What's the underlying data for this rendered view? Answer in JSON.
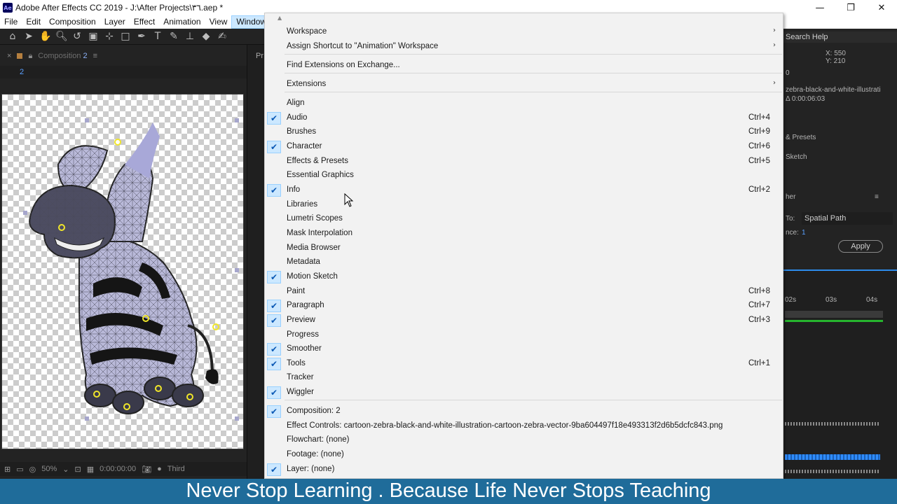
{
  "window": {
    "app_icon": "Ae",
    "title": "Adobe After Effects CC 2019 - J:\\After Projects\\٣٦.aep *",
    "minimize": "—",
    "restore": "❐",
    "close": "✕"
  },
  "menubar": {
    "items": [
      "File",
      "Edit",
      "Composition",
      "Layer",
      "Effect",
      "Animation",
      "View",
      "Window"
    ],
    "active": "Window"
  },
  "toolbar": {
    "icons": [
      "home-icon",
      "selection-tool-icon",
      "hand-tool-icon",
      "zoom-tool-icon",
      "rotate-tool-icon",
      "camera-tool-icon",
      "pan-behind-tool-icon",
      "rectangle-tool-icon",
      "pen-tool-icon",
      "type-tool-icon",
      "brush-tool-icon",
      "clone-stamp-tool-icon",
      "eraser-tool-icon",
      "roto-brush-tool-icon"
    ]
  },
  "composition_panel": {
    "tab_label_prefix": "Composition ",
    "tab_label_number": "2",
    "sub_tab": "2",
    "footer": {
      "zoom": "50%",
      "timecode": "0:00:00:00",
      "view": "Third"
    }
  },
  "middle_strip": {
    "label": "Pr"
  },
  "right_panel": {
    "search_help": "Search Help",
    "info_xy": "X: 550\nY: 210",
    "info_value": "0",
    "project_item": "zebra-black-and-white-illustrati",
    "duration": "Δ 0:00:06:03",
    "effects_presets": "& Presets",
    "motion_sketch": "Sketch",
    "smoother": "her",
    "apply_to_label": "To:",
    "apply_to_value": "Spatial Path",
    "tolerance_label": "nce:",
    "tolerance_value": "1",
    "apply_button": "Apply",
    "ruler_ticks": [
      "02s",
      "03s",
      "04s"
    ]
  },
  "window_menu": {
    "items": [
      {
        "label": "Workspace",
        "checked": false,
        "shortcut": "",
        "submenu": true
      },
      {
        "label": "Assign Shortcut to \"Animation\" Workspace",
        "checked": false,
        "shortcut": "",
        "submenu": true
      },
      {
        "label": "Find Extensions on Exchange...",
        "checked": false,
        "shortcut": "",
        "submenu": false
      },
      {
        "label": "Extensions",
        "checked": false,
        "shortcut": "",
        "submenu": true
      },
      {
        "label": "Align",
        "checked": false,
        "shortcut": "",
        "submenu": false
      },
      {
        "label": "Audio",
        "checked": true,
        "shortcut": "Ctrl+4",
        "submenu": false
      },
      {
        "label": "Brushes",
        "checked": false,
        "shortcut": "Ctrl+9",
        "submenu": false
      },
      {
        "label": "Character",
        "checked": true,
        "shortcut": "Ctrl+6",
        "submenu": false
      },
      {
        "label": "Effects & Presets",
        "checked": false,
        "shortcut": "Ctrl+5",
        "submenu": false
      },
      {
        "label": "Essential Graphics",
        "checked": false,
        "shortcut": "",
        "submenu": false
      },
      {
        "label": "Info",
        "checked": true,
        "shortcut": "Ctrl+2",
        "submenu": false
      },
      {
        "label": "Libraries",
        "checked": false,
        "shortcut": "",
        "submenu": false
      },
      {
        "label": "Lumetri Scopes",
        "checked": false,
        "shortcut": "",
        "submenu": false
      },
      {
        "label": "Mask Interpolation",
        "checked": false,
        "shortcut": "",
        "submenu": false
      },
      {
        "label": "Media Browser",
        "checked": false,
        "shortcut": "",
        "submenu": false
      },
      {
        "label": "Metadata",
        "checked": false,
        "shortcut": "",
        "submenu": false
      },
      {
        "label": "Motion Sketch",
        "checked": true,
        "shortcut": "",
        "submenu": false
      },
      {
        "label": "Paint",
        "checked": false,
        "shortcut": "Ctrl+8",
        "submenu": false
      },
      {
        "label": "Paragraph",
        "checked": true,
        "shortcut": "Ctrl+7",
        "submenu": false
      },
      {
        "label": "Preview",
        "checked": true,
        "shortcut": "Ctrl+3",
        "submenu": false
      },
      {
        "label": "Progress",
        "checked": false,
        "shortcut": "",
        "submenu": false
      },
      {
        "label": "Smoother",
        "checked": true,
        "shortcut": "",
        "submenu": false
      },
      {
        "label": "Tools",
        "checked": true,
        "shortcut": "Ctrl+1",
        "submenu": false
      },
      {
        "label": "Tracker",
        "checked": false,
        "shortcut": "",
        "submenu": false
      },
      {
        "label": "Wiggler",
        "checked": true,
        "shortcut": "",
        "submenu": false
      },
      {
        "label": "Composition: 2",
        "checked": true,
        "shortcut": "",
        "submenu": false
      },
      {
        "label": "Effect Controls: cartoon-zebra-black-and-white-illustration-cartoon-zebra-vector-9ba604497f18e493313f2d6b5dcfc843.png",
        "checked": false,
        "shortcut": "",
        "submenu": false
      },
      {
        "label": "Flowchart: (none)",
        "checked": false,
        "shortcut": "",
        "submenu": false
      },
      {
        "label": "Footage: (none)",
        "checked": false,
        "shortcut": "",
        "submenu": false
      },
      {
        "label": "Layer: (none)",
        "checked": true,
        "shortcut": "",
        "submenu": false
      }
    ]
  },
  "caption": "Never Stop Learning . Because Life Never Stops Teaching",
  "colors": {
    "accent_blue": "#2d8ceb",
    "check_bg": "#cce8ff",
    "caption_bg": "#1f6c9a",
    "pin_yellow": "#f0e62a"
  }
}
